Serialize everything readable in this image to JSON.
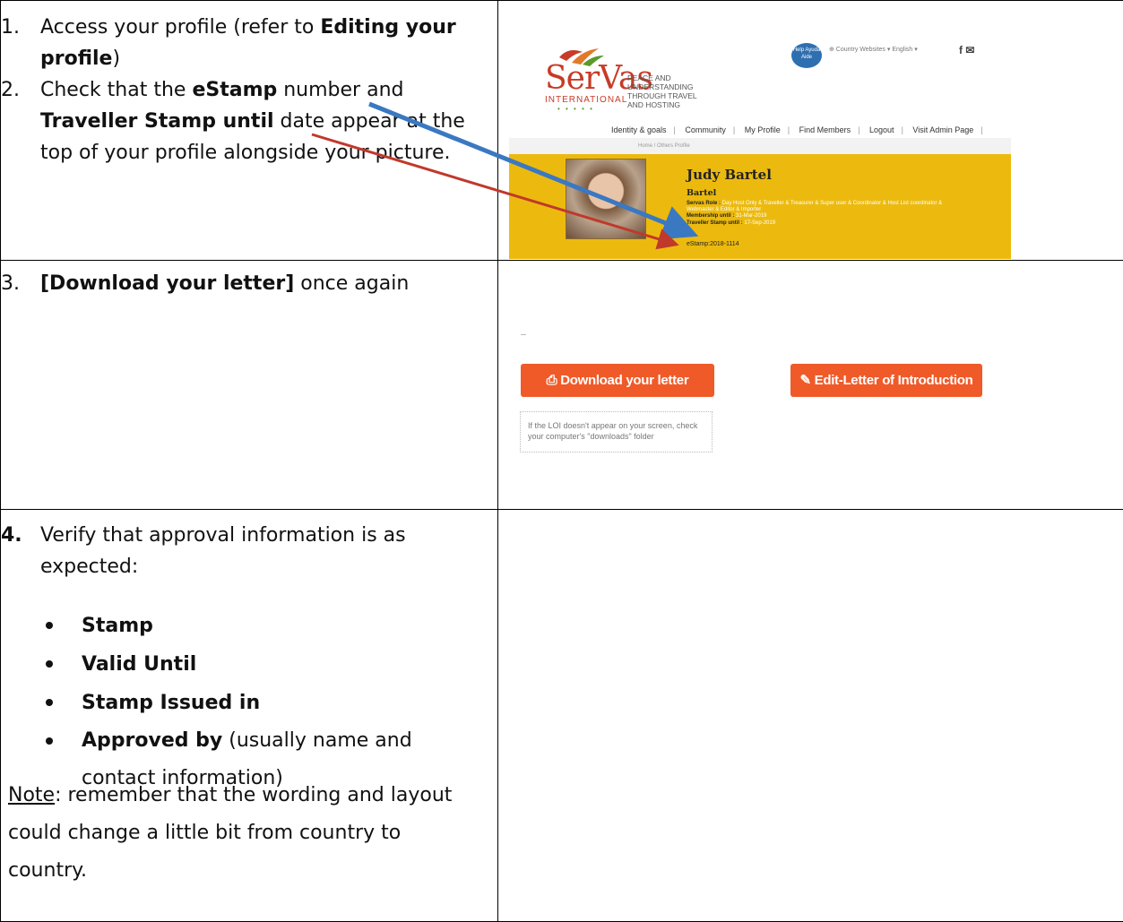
{
  "step1": {
    "num": "1.",
    "text_a": "Access your profile (refer to ",
    "bold": "Editing your profile",
    "text_b": ")"
  },
  "step2": {
    "num": "2.",
    "text_a": "Check that the ",
    "bold_a": "eStamp",
    "text_b": " number and ",
    "bold_b": "Traveller Stamp until",
    "text_c": " date appear at the top of your profile alongside your picture."
  },
  "step3": {
    "num": "3.",
    "bold": "[Download your letter]",
    "text": " once again"
  },
  "step4": {
    "num": "4.",
    "text": "Verify that approval information is as expected:",
    "bullets": [
      {
        "bold": "Stamp",
        "rest": ""
      },
      {
        "bold": "Valid Until",
        "rest": ""
      },
      {
        "bold": "Stamp Issued in",
        "rest": ""
      },
      {
        "bold": "Approved by",
        "rest": " (usually name and contact information)"
      }
    ]
  },
  "note": {
    "label": "Note",
    "text": ":  remember that the wording and layout could change a little bit from country to country."
  },
  "shot1": {
    "logo": "SerVas",
    "logo_sub": "INTERNATIONAL",
    "logo_dots": "• • • • •",
    "tagline": "PEACE AND UNDERSTANDING THROUGH TRAVEL AND HOSTING",
    "help": "Help Ayuda Aide",
    "top_links": "⊕ Country Websites  ▾   English     ▾",
    "social": "f ✉",
    "nav": [
      "Identity & goals",
      "Community",
      "My Profile",
      "Find Members",
      "Logout",
      "Visit Admin Page"
    ],
    "breadcrumb": "Home  /  Others Profile",
    "name": "Judy Bartel",
    "lastname": "Bartel",
    "role_label": "Servas Role :",
    "role": " Day Host Only & Traveller & Treasurer & Super user & Coordinator & Host List coordinator & Webmaster & Editor & Importer",
    "membership_label": "Membership until :",
    "membership": " 31-Mar-2019",
    "traveller_label": "Traveller Stamp until :",
    "traveller": " 17-Sep-2019",
    "estamp": "eStamp:2018-1114"
  },
  "shot2": {
    "download_label": "⎙ Download your letter",
    "edit_label": "✎ Edit-Letter of Introduction",
    "hint": "If the LOI doesn't appear on your screen, check your computer's \"downloads\" folder"
  },
  "colors": {
    "accent": "#f05a28",
    "banner": "#ecba0e",
    "arrow_blue": "#3a78c2",
    "arrow_red": "#c0392b"
  }
}
